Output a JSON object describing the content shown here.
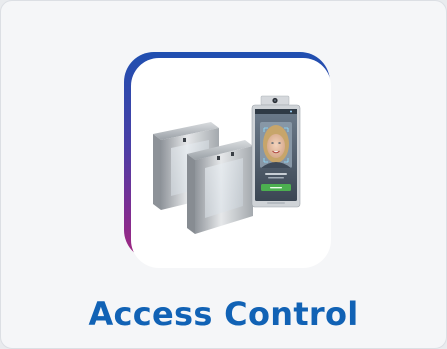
{
  "card": {
    "title": "Access Control",
    "image": {
      "subject": "access-control-devices",
      "items": [
        "speed-gate-turnstile",
        "face-recognition-terminal"
      ]
    }
  },
  "colors": {
    "title": "#1162b5",
    "gradient_top": "#1f4fb0",
    "gradient_bottom": "#a3267f",
    "card_background": "#f5f6f8",
    "tile_background": "#ffffff",
    "verified_green": "#4caf50"
  }
}
